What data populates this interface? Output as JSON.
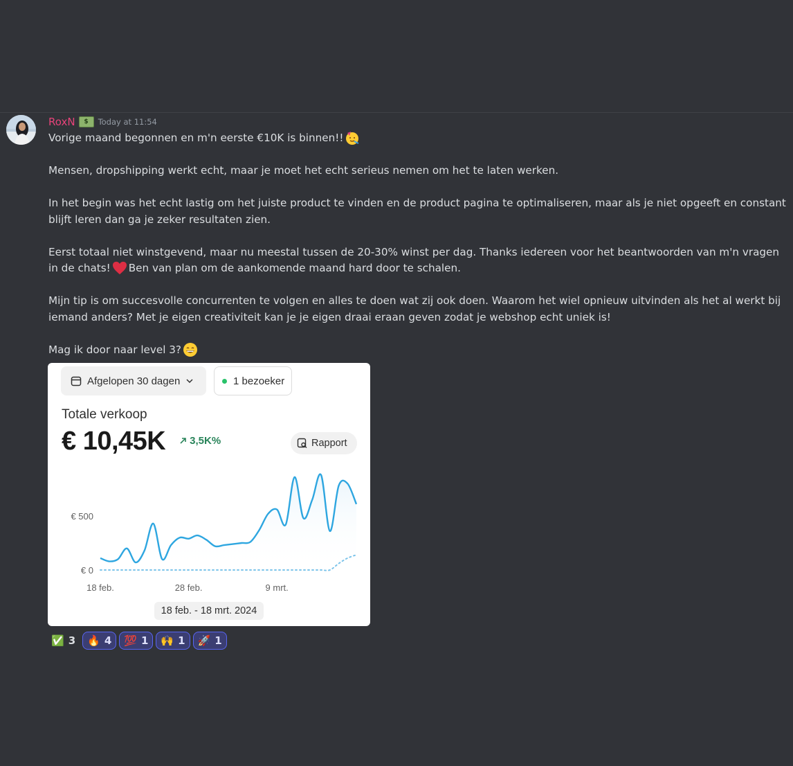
{
  "message": {
    "username": "RoxN",
    "role_badge_icon": "money-icon",
    "timestamp": "Today at 11:54",
    "paragraphs": [
      "Vorige maand begonnen en m'n eerste €10K is binnen!!",
      "Mensen, dropshipping werkt echt, maar je moet het echt serieus nemen om het te laten werken.",
      "In het begin was het echt lastig om het juiste product te vinden en de product pagina te optimaliseren, maar als je niet opgeeft en constant blijft leren dan ga je zeker resultaten zien.",
      "Eerst totaal niet winstgevend, maar nu meestal tussen de 20-30% winst per dag. Thanks iedereen voor het beantwoorden van m'n vragen in de chats!",
      "Ben van plan om de aankomende maand hard door te schalen.",
      "Mijn tip is om succesvolle concurrenten te volgen en alles te doen wat zij ook doen. Waarom het wiel opnieuw uitvinden als het al werkt bij iemand anders? Met je eigen creativiteit kan je je eigen draai eraan geven zodat je webshop echt uniek is!",
      "Mag ik door naar level 3?"
    ]
  },
  "embed": {
    "date_filter": "Afgelopen 30 dagen",
    "visitors": "1 bezoeker",
    "metric_title": "Totale verkoop",
    "metric_value": "€ 10,45K",
    "metric_change": "3,5K%",
    "report_label": "Rapport",
    "date_range": "18 feb. - 18 mrt. 2024"
  },
  "chart_data": {
    "type": "line",
    "y_tick_labels": [
      "€ 500",
      "€ 0"
    ],
    "x_tick_labels": [
      "18 feb.",
      "28 feb.",
      "9 mrt."
    ],
    "ylim": [
      0,
      1000
    ],
    "x": [
      "18 feb.",
      "19 feb.",
      "20 feb.",
      "21 feb.",
      "22 feb.",
      "23 feb.",
      "24 feb.",
      "25 feb.",
      "26 feb.",
      "27 feb.",
      "28 feb.",
      "29 feb.",
      "1 mrt.",
      "2 mrt.",
      "3 mrt.",
      "4 mrt.",
      "5 mrt.",
      "6 mrt.",
      "7 mrt.",
      "8 mrt.",
      "9 mrt.",
      "10 mrt.",
      "11 mrt.",
      "12 mrt.",
      "13 mrt.",
      "14 mrt.",
      "15 mrt.",
      "16 mrt.",
      "17 mrt.",
      "18 mrt."
    ],
    "series": [
      {
        "values": [
          110,
          80,
          100,
          200,
          70,
          180,
          430,
          100,
          230,
          300,
          290,
          320,
          280,
          220,
          230,
          240,
          250,
          260,
          370,
          520,
          560,
          420,
          860,
          480,
          650,
          880,
          360,
          780,
          800,
          610
        ],
        "color": "#2ea6e0",
        "style": "solid"
      },
      {
        "values": [
          0,
          0,
          0,
          0,
          0,
          0,
          0,
          0,
          0,
          0,
          0,
          0,
          0,
          0,
          0,
          0,
          0,
          0,
          0,
          0,
          0,
          0,
          0,
          0,
          0,
          0,
          0,
          60,
          110,
          140
        ],
        "color": "#7cc4ea",
        "style": "dotted"
      }
    ],
    "grid": false
  },
  "reactions": [
    {
      "emoji": "✅",
      "count": "3",
      "active": false
    },
    {
      "emoji": "🔥",
      "count": "4",
      "active": true
    },
    {
      "emoji": "💯",
      "count": "1",
      "active": true
    },
    {
      "emoji": "🙌",
      "count": "1",
      "active": true
    },
    {
      "emoji": "🚀",
      "count": "1",
      "active": true
    }
  ]
}
